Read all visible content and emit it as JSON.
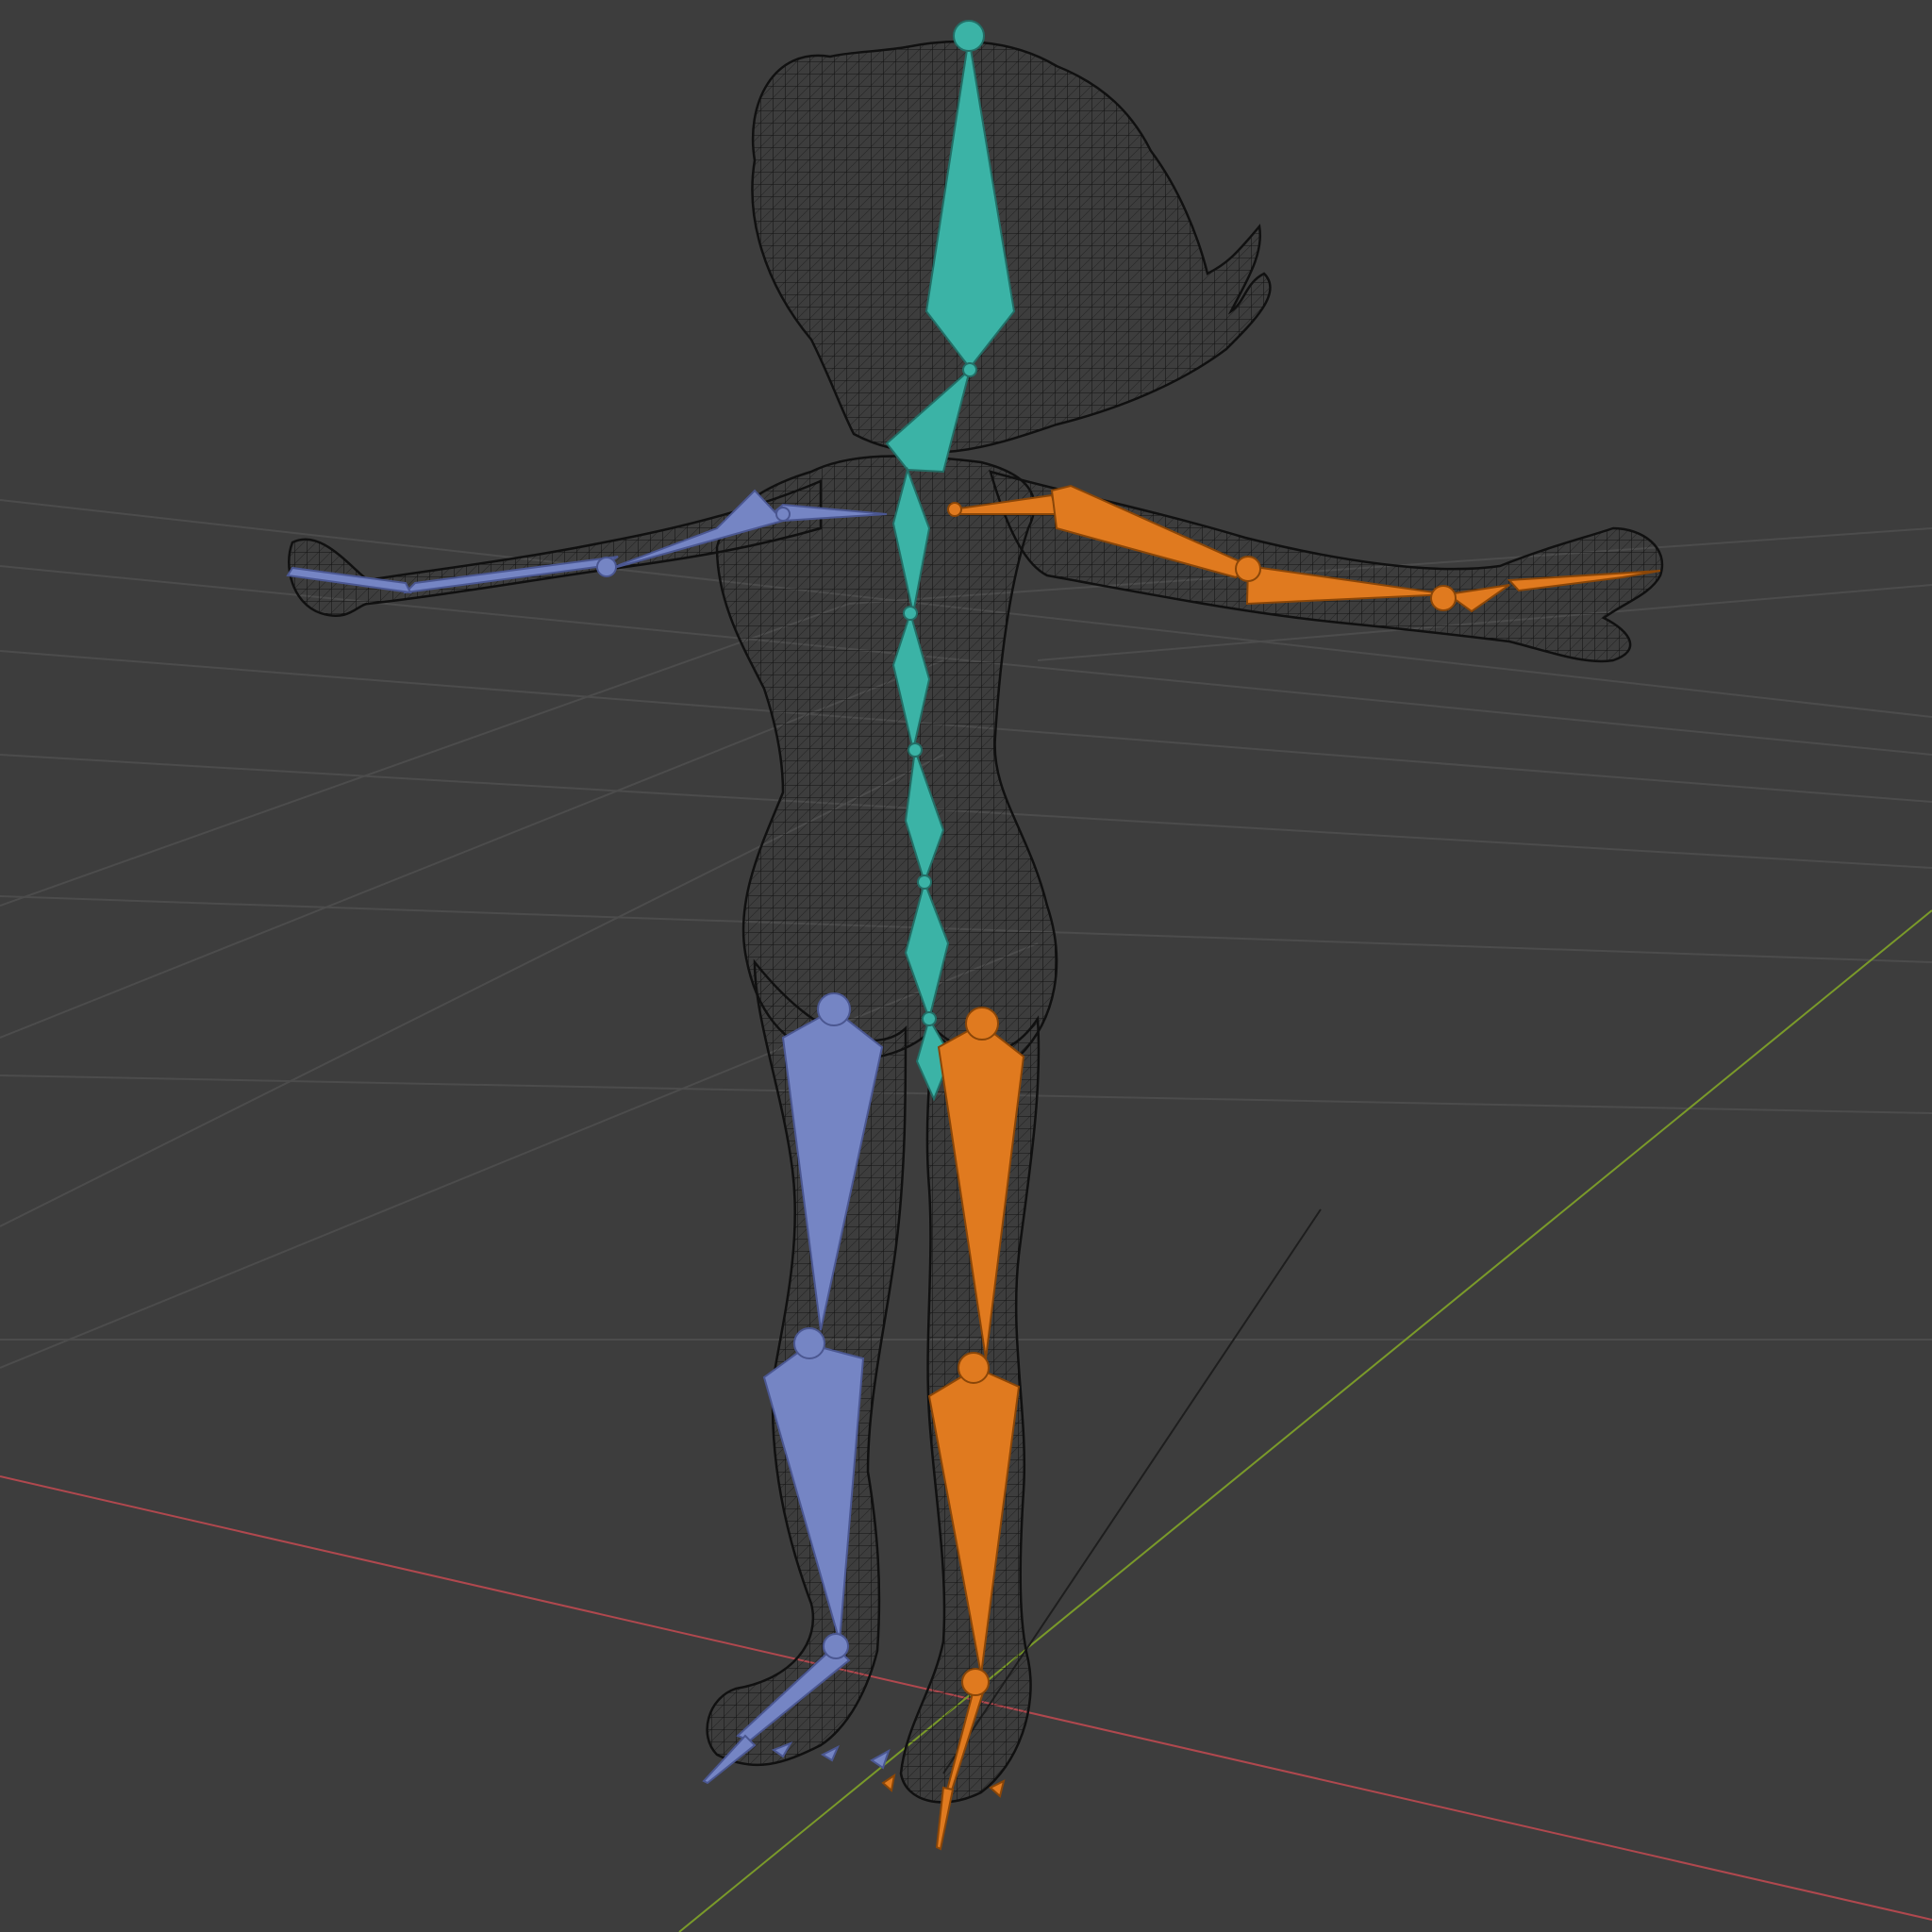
{
  "viewport": {
    "background": "#3d3d3d",
    "view_mode": "wireframe",
    "subject": "armature-over-character-mesh"
  },
  "colors": {
    "grid_line": "#4c4c4c",
    "axis_x": "#b0484e",
    "axis_y": "#7a9a2a",
    "axis_z": "#1e1e1e",
    "wireframe": "#141414",
    "bone_spine": "#3bb3a6",
    "bone_spine_dark": "#2b8c82",
    "bone_left": "#7585c4",
    "bone_left_dark": "#5a68a3",
    "bone_right": "#e07a1f",
    "bone_right_dark": "#b45c10"
  },
  "bone_groups": [
    "spine",
    "left",
    "right"
  ]
}
